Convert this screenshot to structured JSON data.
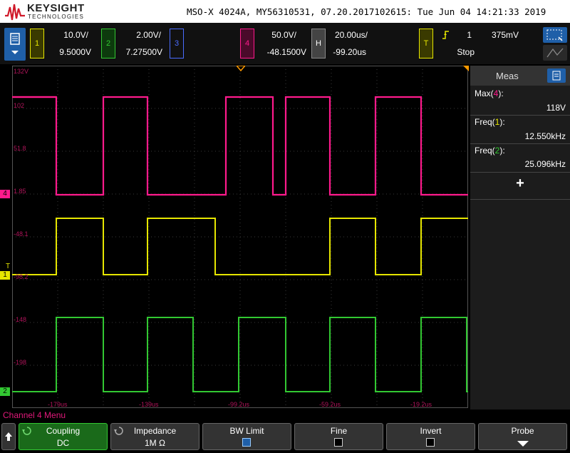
{
  "header": {
    "brand": "KEYSIGHT",
    "brand_sub": "TECHNOLOGIES",
    "instrument": "MSO-X 4024A, MY56310531, 07.20.2017102615: Tue Jun 04 14:21:33 2019"
  },
  "channels": [
    {
      "num": "1",
      "scale": "10.0V/",
      "offset": "9.5000V",
      "color": "#e6e600"
    },
    {
      "num": "2",
      "scale": "2.00V/",
      "offset": "7.27500V",
      "color": "#32c832"
    },
    {
      "num": "3",
      "scale": "",
      "offset": "",
      "color": "#4a6cff"
    },
    {
      "num": "4",
      "scale": "50.0V/",
      "offset": "-48.1500V",
      "color": "#ff1a8c"
    }
  ],
  "horizontal": {
    "label": "H",
    "scale": "20.00us/",
    "delay": "-99.20us"
  },
  "trigger": {
    "label": "T",
    "source": "1",
    "level": "375mV",
    "mode": "Stop"
  },
  "graticule": {
    "y_labels": [
      "132V",
      "102",
      "51.8",
      "1.85",
      "-48.1",
      "-98.2",
      "-148",
      "-198"
    ],
    "x_labels": [
      "-179us",
      "-139us",
      "-99.2us",
      "-59.2us",
      "-19.2us"
    ]
  },
  "markers": {
    "ch4": "4",
    "ch1": "1",
    "ch2": "2",
    "trig": "T"
  },
  "meas": {
    "title": "Meas",
    "items": [
      {
        "name_pre": "Max(",
        "src": "4",
        "name_post": "):",
        "src_color": "#ff1a8c",
        "value": "118V"
      },
      {
        "name_pre": "Freq(",
        "src": "1",
        "name_post": "):",
        "src_color": "#e6e600",
        "value": "12.550kHz"
      },
      {
        "name_pre": "Freq(",
        "src": "2",
        "name_post": "):",
        "src_color": "#32c832",
        "value": "25.096kHz"
      }
    ],
    "add": "+"
  },
  "softkeys": {
    "menu_title": "Channel 4 Menu",
    "coupling": {
      "label": "Coupling",
      "value": "DC"
    },
    "impedance": {
      "label": "Impedance",
      "value": "1M Ω"
    },
    "bwlimit": {
      "label": "BW Limit"
    },
    "fine": {
      "label": "Fine"
    },
    "invert": {
      "label": "Invert"
    },
    "probe": {
      "label": "Probe"
    }
  }
}
